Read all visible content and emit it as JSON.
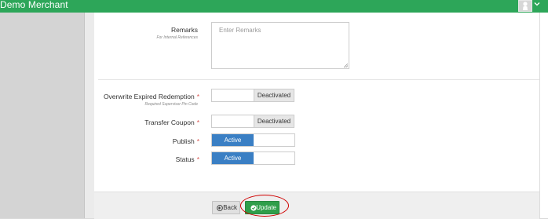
{
  "header": {
    "brand": "Demo Merchant",
    "user_icon": "user-icon",
    "menu_icon": "chevron-down-icon"
  },
  "form": {
    "remarks": {
      "label": "Remarks",
      "hint": "For Internal References",
      "placeholder": "Enter Remarks"
    },
    "overwrite": {
      "label": "Overwrite Expired Redemption",
      "required": "*",
      "hint": "Required Supervisor Pin Code",
      "status": "Deactivated"
    },
    "transfer": {
      "label": "Transfer Coupon",
      "required": "*",
      "status": "Deactivated"
    },
    "publish": {
      "label": "Publish",
      "required": "*",
      "active": "Active"
    },
    "status": {
      "label": "Status",
      "required": "*",
      "active": "Active"
    }
  },
  "footer": {
    "back_label": "Back",
    "update_label": "Update"
  },
  "colors": {
    "header_green": "#2da659",
    "active_blue": "#3a7fc4",
    "update_green": "#2f9e4a",
    "required_red": "#d9534f",
    "highlight_red": "#d00000"
  }
}
